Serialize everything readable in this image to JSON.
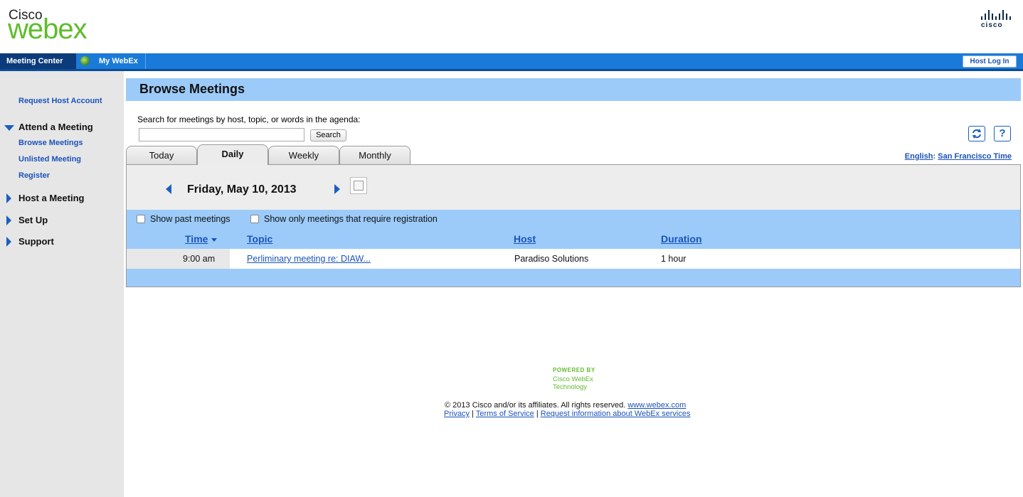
{
  "brand": {
    "cisco_label": "Cisco",
    "webex_label": "webex",
    "corp_logo": "cisco"
  },
  "nav": {
    "meeting_center": "Meeting Center",
    "my_webex": "My WebEx",
    "host_login": "Host Log In"
  },
  "sidebar": {
    "request_host_account": "Request Host Account",
    "attend": {
      "heading": "Attend a Meeting",
      "items": [
        "Browse Meetings",
        "Unlisted Meeting",
        "Register"
      ]
    },
    "host": "Host a Meeting",
    "setup": "Set Up",
    "support": "Support"
  },
  "main": {
    "title": "Browse Meetings",
    "search_label": "Search for meetings by host, topic, or words in the agenda:",
    "search_value": "",
    "search_button": "Search",
    "refresh_icon": "refresh-icon",
    "help_icon_label": "?",
    "language": "English",
    "separator": ":",
    "timezone": "San Francisco Time",
    "tabs": [
      "Today",
      "Daily",
      "Weekly",
      "Monthly"
    ],
    "active_tab": "Daily",
    "date": "Friday, May 10, 2013",
    "filters": {
      "past": "Show past meetings",
      "registration": "Show only meetings that require registration"
    },
    "columns": [
      "Time",
      "Topic",
      "Host",
      "Duration"
    ],
    "rows": [
      {
        "time": "9:00 am",
        "topic": "Perliminary meeting  re: DIAW...",
        "host": "Paradiso Solutions",
        "duration": "1 hour"
      }
    ]
  },
  "footer": {
    "powered_by": "POWERED BY",
    "tech": "Cisco WebEx Technology",
    "copyright": "© 2013 Cisco and/or its affiliates. All rights reserved.",
    "site_link": "www.webex.com",
    "links": [
      "Privacy",
      "Terms of Service",
      "Request information about WebEx services"
    ],
    "link_separator": "|"
  },
  "colors": {
    "brand_green": "#5fbc2d",
    "nav_blue": "#1a7ad9",
    "nav_dark": "#0b3b7a",
    "band_blue": "#9ccbf9",
    "link": "#1b53b9"
  }
}
